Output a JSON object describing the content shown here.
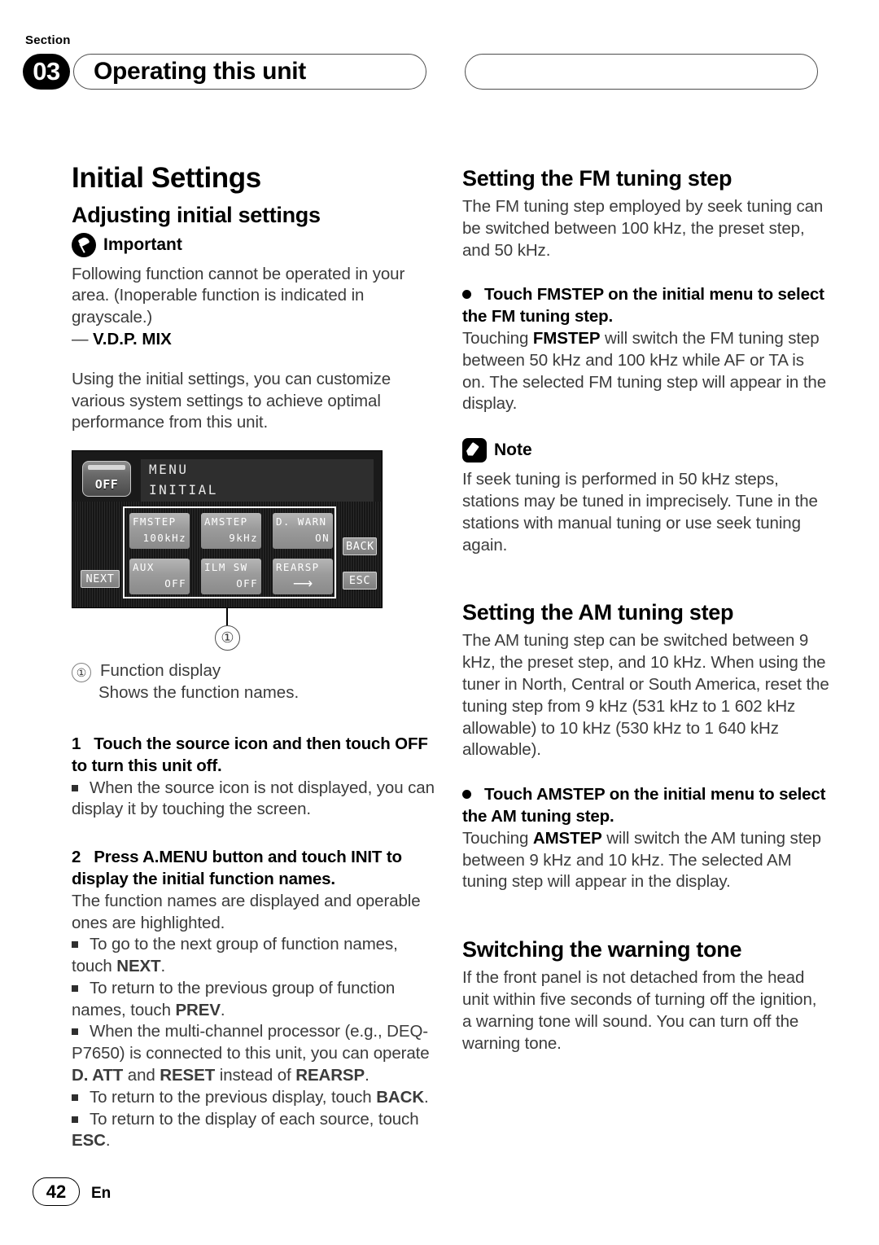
{
  "header": {
    "section_label": "Section",
    "section_number": "03",
    "title": "Operating this unit"
  },
  "left_column": {
    "h1": "Initial Settings",
    "h2": "Adjusting initial settings",
    "important_label": "Important",
    "important_body": "Following function cannot be operated in your area. (Inoperable function is indicated in grayscale.)",
    "important_dash_item": "V.D.P. MIX",
    "intro_paragraph": "Using the initial settings, you can customize various system settings to achieve optimal performance from this unit.",
    "figure": {
      "lcd": {
        "off_button": "OFF",
        "menu_line_1": "MENU",
        "menu_line_2": "INITIAL",
        "function_buttons": [
          {
            "name": "FMSTEP",
            "value": "100kHz"
          },
          {
            "name": "AMSTEP",
            "value": "9kHz"
          },
          {
            "name": "D. WARN",
            "value": "ON"
          },
          {
            "name": "AUX",
            "value": "OFF"
          },
          {
            "name": "ILM SW",
            "value": "OFF"
          },
          {
            "name": "REARSP",
            "value": "⟶"
          }
        ],
        "next_button": "NEXT",
        "back_button": "BACK",
        "esc_button": "ESC"
      },
      "callout_marker": "①",
      "legend_marker": "①",
      "legend_title": "Function display",
      "legend_desc": "Shows the function names."
    },
    "step1": {
      "number": "1",
      "text": "Touch the source icon and then touch OFF to turn this unit off.",
      "notes": [
        "When the source icon is not displayed, you can display it by touching the screen."
      ]
    },
    "step2": {
      "number": "2",
      "text": "Press A.MENU button and touch INIT to display the initial function names.",
      "body": "The function names are displayed and operable ones are highlighted.",
      "notes_html": [
        "To go to the next group of function names, touch <b>NEXT</b>.",
        "To return to the previous group of function names, touch <b>PREV</b>.",
        "When the multi-channel processor (e.g., DEQ-P7650) is connected to this unit, you can operate <b>D. ATT</b> and <b>RESET</b> instead of <b>REARSP</b>.",
        "To return to the previous display, touch <b>BACK</b>.",
        "To return to the display of each source, touch <b>ESC</b>."
      ]
    }
  },
  "right_column": {
    "fm": {
      "heading": "Setting the FM tuning step",
      "body": "The FM tuning step employed by seek tuning can be switched between 100 kHz, the preset step, and 50 kHz.",
      "bullet_heading": "Touch FMSTEP on the initial menu to select the FM tuning step.",
      "bullet_body_html": "Touching <b>FMSTEP</b> will switch the FM tuning step between 50 kHz and 100 kHz while AF or TA is on. The selected FM tuning step will appear in the display.",
      "note_label": "Note",
      "note_body": "If seek tuning is performed in 50 kHz steps, stations may be tuned in imprecisely. Tune in the stations with manual tuning or use seek tuning again."
    },
    "am": {
      "heading": "Setting the AM tuning step",
      "body": "The AM tuning step can be switched between 9 kHz, the preset step, and 10 kHz. When using the tuner in North, Central or South America, reset the tuning step from 9 kHz (531 kHz to 1 602 kHz allowable) to 10 kHz (530 kHz to 1 640 kHz allowable).",
      "bullet_heading": "Touch AMSTEP on the initial menu to select the AM tuning step.",
      "bullet_body_html": "Touching <b>AMSTEP</b> will switch the AM tuning step between 9 kHz and 10 kHz. The selected AM tuning step will appear in the display."
    },
    "warning": {
      "heading": "Switching the warning tone",
      "body": "If the front panel is not detached from the head unit within five seconds of turning off the ignition, a warning tone will sound. You can turn off the warning tone."
    }
  },
  "footer": {
    "page_number": "42",
    "language": "En"
  }
}
